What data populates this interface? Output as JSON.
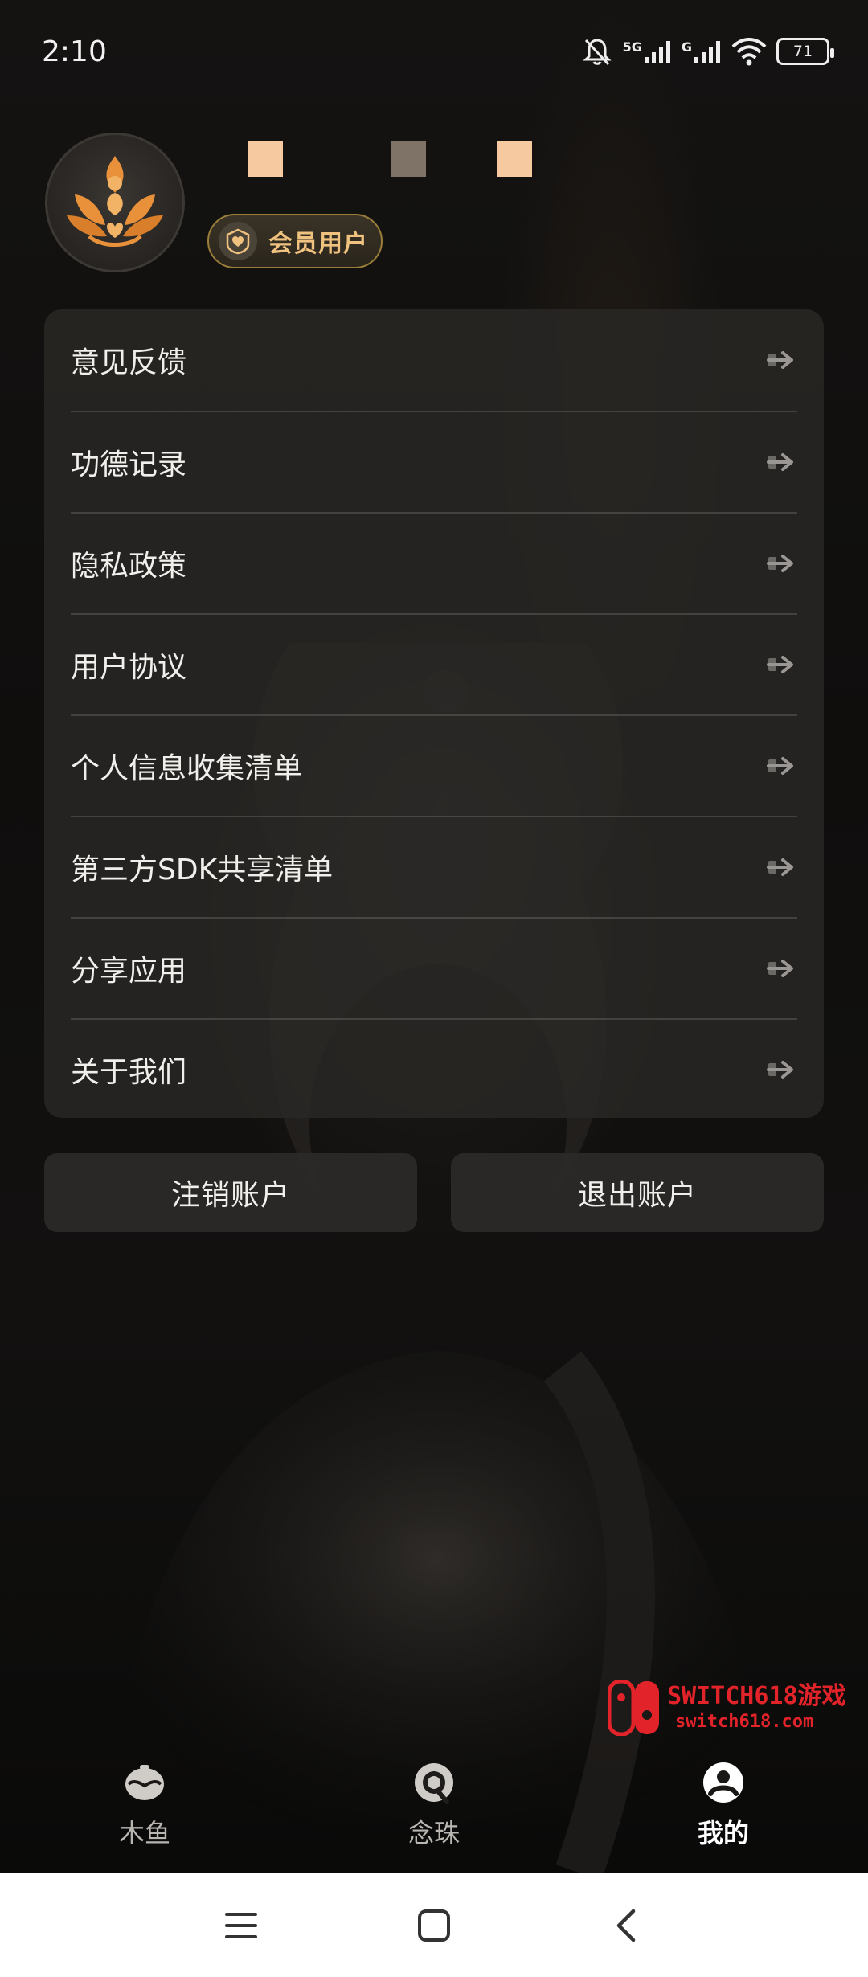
{
  "status_bar": {
    "time": "2:10",
    "network_1": "5G",
    "network_2": "G",
    "battery": "71"
  },
  "profile": {
    "member_label": "会员用户",
    "username_colors": [
      "#f6c9a0",
      "#7f7266",
      "#f6c9a0"
    ]
  },
  "menu": {
    "items": [
      {
        "label": "意见反馈"
      },
      {
        "label": "功德记录"
      },
      {
        "label": "隐私政策"
      },
      {
        "label": "用户协议"
      },
      {
        "label": "个人信息收集清单"
      },
      {
        "label": "第三方SDK共享清单"
      },
      {
        "label": "分享应用"
      },
      {
        "label": "关于我们"
      }
    ]
  },
  "actions": {
    "cancel_account": "注销账户",
    "logout": "退出账户"
  },
  "watermark": {
    "line1": "SWITCH618游戏",
    "line2": "switch618.com"
  },
  "tabs": [
    {
      "label": "木鱼",
      "icon": "wooden-fish-icon",
      "active": false
    },
    {
      "label": "念珠",
      "icon": "prayer-beads-icon",
      "active": false
    },
    {
      "label": "我的",
      "icon": "profile-icon",
      "active": true
    }
  ],
  "colors": {
    "accent_gold": "#f0c27f",
    "avatar_orange": "#e8913a",
    "watermark_red": "#e3232a"
  }
}
